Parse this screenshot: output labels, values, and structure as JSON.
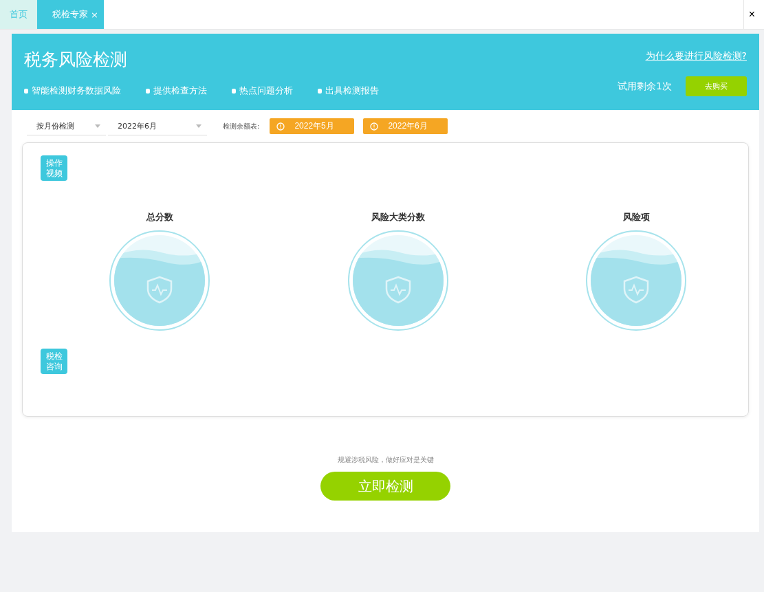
{
  "tabs": [
    {
      "label": "首页",
      "selected": false
    },
    {
      "label": "税检专家",
      "selected": true,
      "close": "×"
    }
  ],
  "window_close": "×",
  "header": {
    "title": "税务风险检测",
    "link": "为什么要进行风险检测?",
    "features": [
      "智能检测财务数据风险",
      "提供检查方法",
      "热点问题分析",
      "出具检测报告"
    ],
    "trial": "试用剩余1次",
    "buy": "去购买"
  },
  "filters": {
    "mode": "按月份检测",
    "month": "2022年6月",
    "balance_label": "检测余额表:",
    "balance_months": [
      "2022年5月",
      "2022年6月"
    ]
  },
  "side_buttons": [
    {
      "line1": "操作",
      "line2": "视频"
    },
    {
      "line1": "税检",
      "line2": "咨询"
    }
  ],
  "gauges": [
    {
      "title": "总分数"
    },
    {
      "title": "风险大类分数"
    },
    {
      "title": "风险项"
    }
  ],
  "slogan": "规避涉税风险，做好应对是关键",
  "start": "立即检测"
}
